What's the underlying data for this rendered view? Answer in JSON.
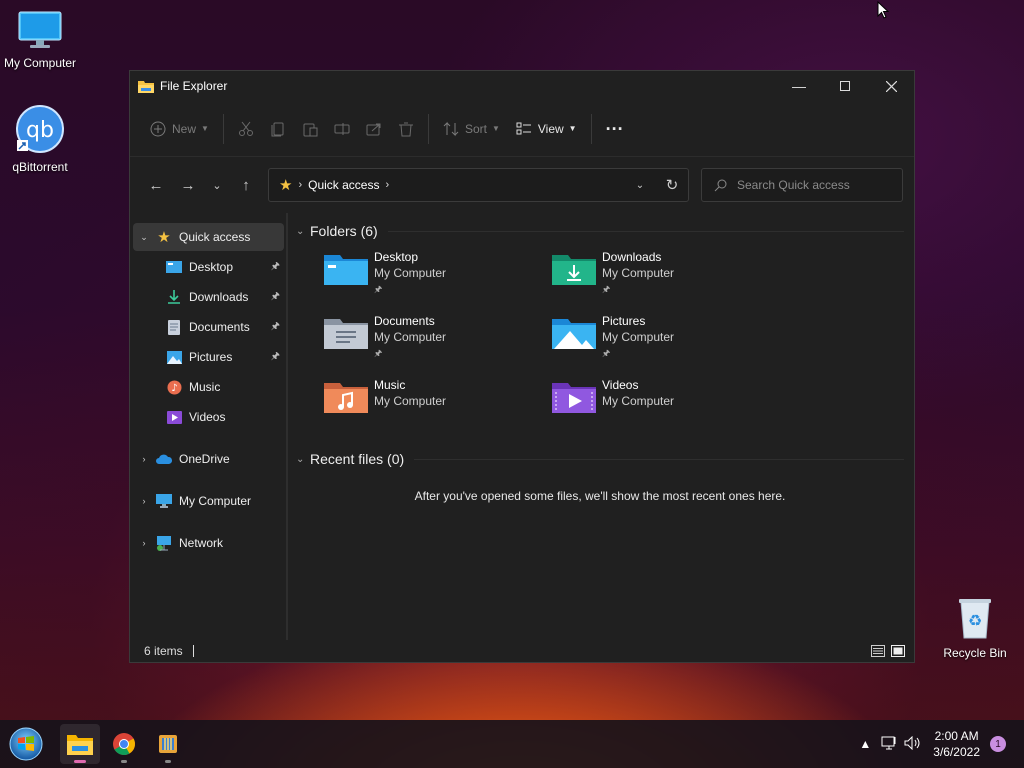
{
  "desktop": {
    "icons": [
      {
        "label": "My Computer"
      },
      {
        "label": "qBittorrent"
      },
      {
        "label": "Recycle Bin"
      }
    ]
  },
  "window": {
    "title": "File Explorer",
    "toolbar": {
      "new_label": "New",
      "sort_label": "Sort",
      "view_label": "View",
      "more_label": "..."
    },
    "address": {
      "crumb": "Quick access"
    },
    "search": {
      "placeholder": "Search Quick access"
    },
    "sidebar": {
      "items": [
        {
          "label": "Quick access"
        },
        {
          "label": "Desktop"
        },
        {
          "label": "Downloads"
        },
        {
          "label": "Documents"
        },
        {
          "label": "Pictures"
        },
        {
          "label": "Music"
        },
        {
          "label": "Videos"
        },
        {
          "label": "OneDrive"
        },
        {
          "label": "My Computer"
        },
        {
          "label": "Network"
        }
      ]
    },
    "folders_header": "Folders (6)",
    "folders": [
      {
        "name": "Desktop",
        "location": "My Computer",
        "icon": "desktop-folder-icon"
      },
      {
        "name": "Downloads",
        "location": "My Computer",
        "icon": "downloads-folder-icon"
      },
      {
        "name": "Documents",
        "location": "My Computer",
        "icon": "documents-folder-icon"
      },
      {
        "name": "Pictures",
        "location": "My Computer",
        "icon": "pictures-folder-icon"
      },
      {
        "name": "Music",
        "location": "My Computer",
        "icon": "music-folder-icon"
      },
      {
        "name": "Videos",
        "location": "My Computer",
        "icon": "videos-folder-icon"
      }
    ],
    "recent_header": "Recent files (0)",
    "recent_empty": "After you've opened some files, we'll show the most recent ones here.",
    "status_count": "6 items"
  },
  "taskbar": {
    "time": "2:00 AM",
    "date": "3/6/2022",
    "notification_count": "1"
  },
  "colors": {
    "window_bg": "#202020",
    "accent_pink": "#e06ab0"
  }
}
